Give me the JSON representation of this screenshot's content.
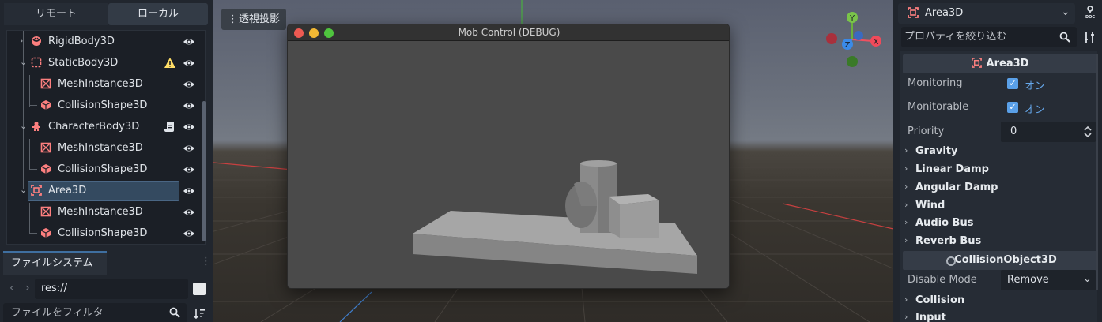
{
  "left_panel": {
    "tabs": {
      "remote": "リモート",
      "local": "ローカル"
    },
    "tree": [
      {
        "label": "RigidBody3D",
        "icon": "rigidbody-icon"
      },
      {
        "label": "StaticBody3D",
        "icon": "staticbody-icon",
        "warning": true
      },
      {
        "label": "MeshInstance3D",
        "icon": "meshinstance-icon"
      },
      {
        "label": "CollisionShape3D",
        "icon": "collisionshape-icon"
      },
      {
        "label": "CharacterBody3D",
        "icon": "characterbody-icon",
        "script": true
      },
      {
        "label": "MeshInstance3D",
        "icon": "meshinstance-icon"
      },
      {
        "label": "CollisionShape3D",
        "icon": "collisionshape-icon"
      },
      {
        "label": "Area3D",
        "icon": "area3d-icon",
        "selected": true
      },
      {
        "label": "MeshInstance3D",
        "icon": "meshinstance-icon"
      },
      {
        "label": "CollisionShape3D",
        "icon": "collisionshape-icon"
      }
    ],
    "filesystem": {
      "tab": "ファイルシステム",
      "path": "res://",
      "filter_placeholder": "ファイルをフィルタ"
    }
  },
  "viewport": {
    "perspective_label": "透視投影",
    "gizmo": {
      "y": "Y",
      "z": "Z",
      "x": "X"
    }
  },
  "game_window": {
    "title": "Mob Control (DEBUG)"
  },
  "inspector": {
    "node_name": "Area3D",
    "filter_placeholder": "プロパティを絞り込む",
    "section_area3d": "Area3D",
    "monitoring": {
      "name": "Monitoring",
      "value": "オン"
    },
    "monitorable": {
      "name": "Monitorable",
      "value": "オン"
    },
    "priority": {
      "name": "Priority",
      "value": "0"
    },
    "groups": [
      "Gravity",
      "Linear Damp",
      "Angular Damp",
      "Wind",
      "Audio Bus",
      "Reverb Bus"
    ],
    "section_collision_object": "CollisionObject3D",
    "disable_mode": {
      "name": "Disable Mode",
      "value": "Remove"
    },
    "groups2": [
      "Collision",
      "Input"
    ]
  }
}
